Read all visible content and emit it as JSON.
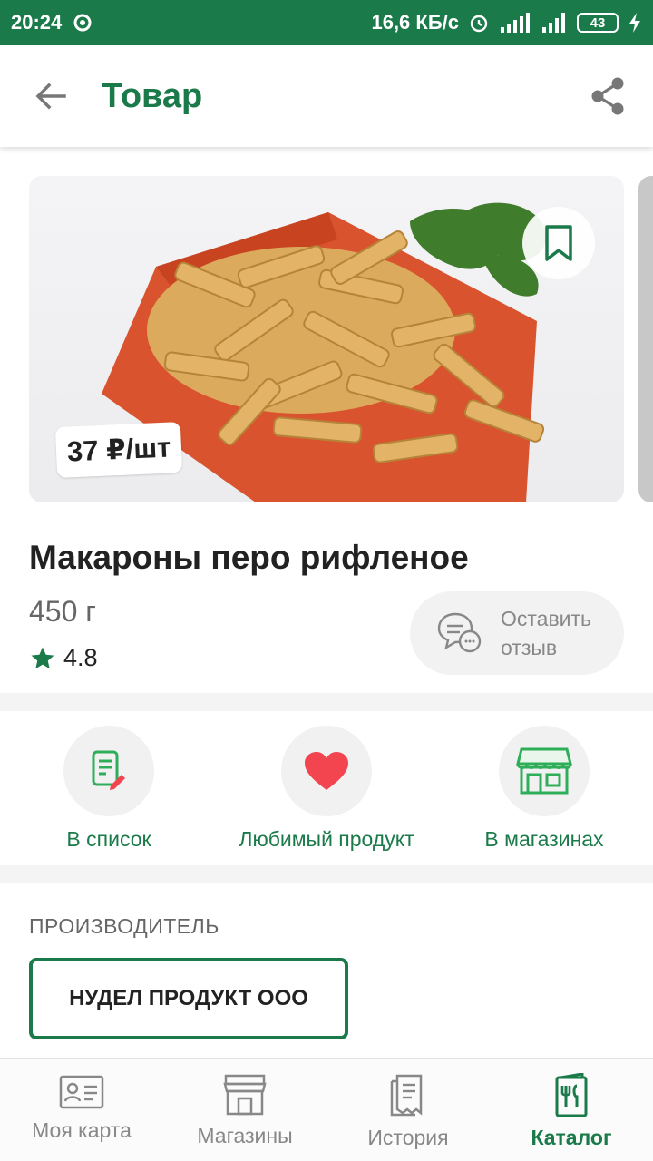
{
  "status_bar": {
    "time": "20:24",
    "network_speed": "16,6 КБ/с",
    "battery": "43",
    "colors": {
      "background": "#1b7a4a"
    }
  },
  "header": {
    "title": "Товар",
    "back_icon": "arrow-left-icon",
    "share_icon": "share-icon"
  },
  "product": {
    "price": "37 ₽/шт",
    "name": "Макароны перо рифленое",
    "weight": "450 г",
    "rating": "4.8",
    "review_button": "Оставить отзыв",
    "bookmark_icon": "bookmark-icon"
  },
  "actions": [
    {
      "label": "В список",
      "icon": "list-edit-icon"
    },
    {
      "label": "Любимый продукт",
      "icon": "heart-icon"
    },
    {
      "label": "В магазинах",
      "icon": "store-icon"
    }
  ],
  "manufacturer": {
    "section_title": "ПРОИЗВОДИТЕЛЬ",
    "name": "НУДЕЛ ПРОДУКТ ООО"
  },
  "bottom_nav": {
    "active": "Каталог",
    "items": [
      {
        "label": "Моя карта",
        "icon": "id-card-icon"
      },
      {
        "label": "Магазины",
        "icon": "shop-icon"
      },
      {
        "label": "История",
        "icon": "receipt-icon"
      },
      {
        "label": "Каталог",
        "icon": "catalog-icon"
      }
    ]
  },
  "theme": {
    "accent": "#1b7a4a",
    "heart": "#f2454f",
    "muted": "#888888"
  }
}
